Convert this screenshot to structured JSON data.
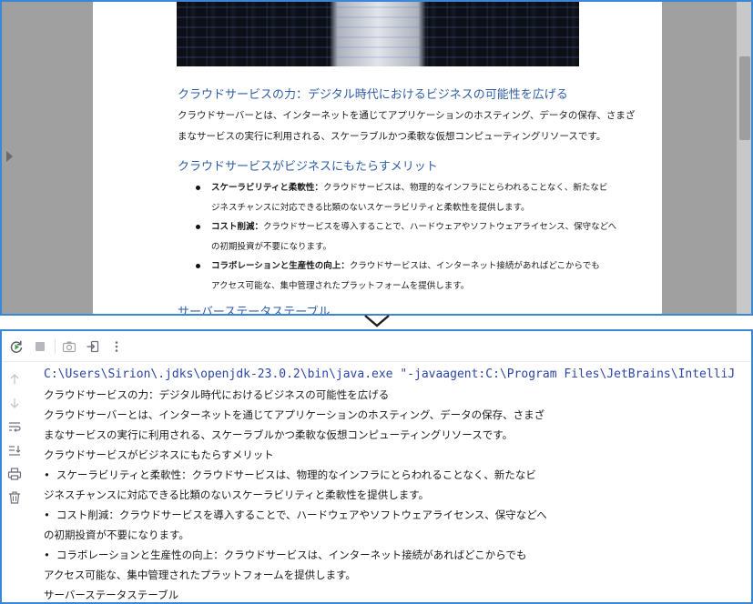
{
  "document": {
    "heading1": "クラウドサービスの力：デジタル時代におけるビジネスの可能性を広げる",
    "para1_line1": "クラウドサーバーとは、インターネットを通じてアプリケーションのホスティング、データの保存、さまざ",
    "para1_line2": "まなサービスの実行に利用される、スケーラブルかつ柔軟な仮想コンピューティングリソースです。",
    "heading2": "クラウドサービスがビジネスにもたらすメリット",
    "bullets": [
      {
        "term": "スケーラビリティと柔軟性：",
        "line1": "クラウドサービスは、物理的なインフラにとらわれることなく、新たなビ",
        "line2": "ジネスチャンスに対応できる比類のないスケーラビリティと柔軟性を提供します。"
      },
      {
        "term": "コスト削減：",
        "line1": "クラウドサービスを導入することで、ハードウェアやソフトウェアライセンス、保守などへ",
        "line2": "の初期投資が不要になります。"
      },
      {
        "term": "コラボレーションと生産性の向上：",
        "line1": "クラウドサービスは、インターネット接続があればどこからでも",
        "line2": "アクセス可能な、集中管理されたプラットフォームを提供します。"
      }
    ],
    "heading3": "サーバーステータステーブル"
  },
  "console": {
    "command": "C:\\Users\\Sirion\\.jdks\\openjdk-23.0.2\\bin\\java.exe \"-javaagent:C:\\Program Files\\JetBrains\\IntelliJ",
    "lines": [
      "クラウドサービスの力：デジタル時代におけるビジネスの可能性を広げる",
      "クラウドサーバーとは、インターネットを通じてアプリケーションのホスティング、データの保存、さまざ",
      "まなサービスの実行に利用される、スケーラブルかつ柔軟な仮想コンピューティングリソースです。",
      "クラウドサービスがビジネスにもたらすメリット",
      "• スケーラビリティと柔軟性：クラウドサービスは、物理的なインフラにとらわれることなく、新たなビ",
      "ジネスチャンスに対応できる比類のないスケーラビリティと柔軟性を提供します。",
      "• コスト削減：クラウドサービスを導入することで、ハードウェアやソフトウェアライセンス、保守などへ",
      "の初期投資が不要になります。",
      "• コラボレーションと生産性の向上：クラウドサービスは、インターネット接続があればどこからでも",
      "アクセス可能な、集中管理されたプラットフォームを提供します。",
      "サーバーステータステーブル"
    ]
  },
  "colors": {
    "accent_border": "#3c86d8",
    "heading_blue": "#2f5ea8",
    "command_blue": "#2b45a8"
  },
  "icons": {
    "toolbar": [
      "rerun-icon",
      "stop-icon",
      "camera-icon",
      "login-icon",
      "more-vertical-icon"
    ],
    "gutter": [
      "arrow-up-icon",
      "arrow-down-icon",
      "soft-wrap-icon",
      "scroll-to-end-icon",
      "print-icon",
      "trash-icon"
    ]
  }
}
